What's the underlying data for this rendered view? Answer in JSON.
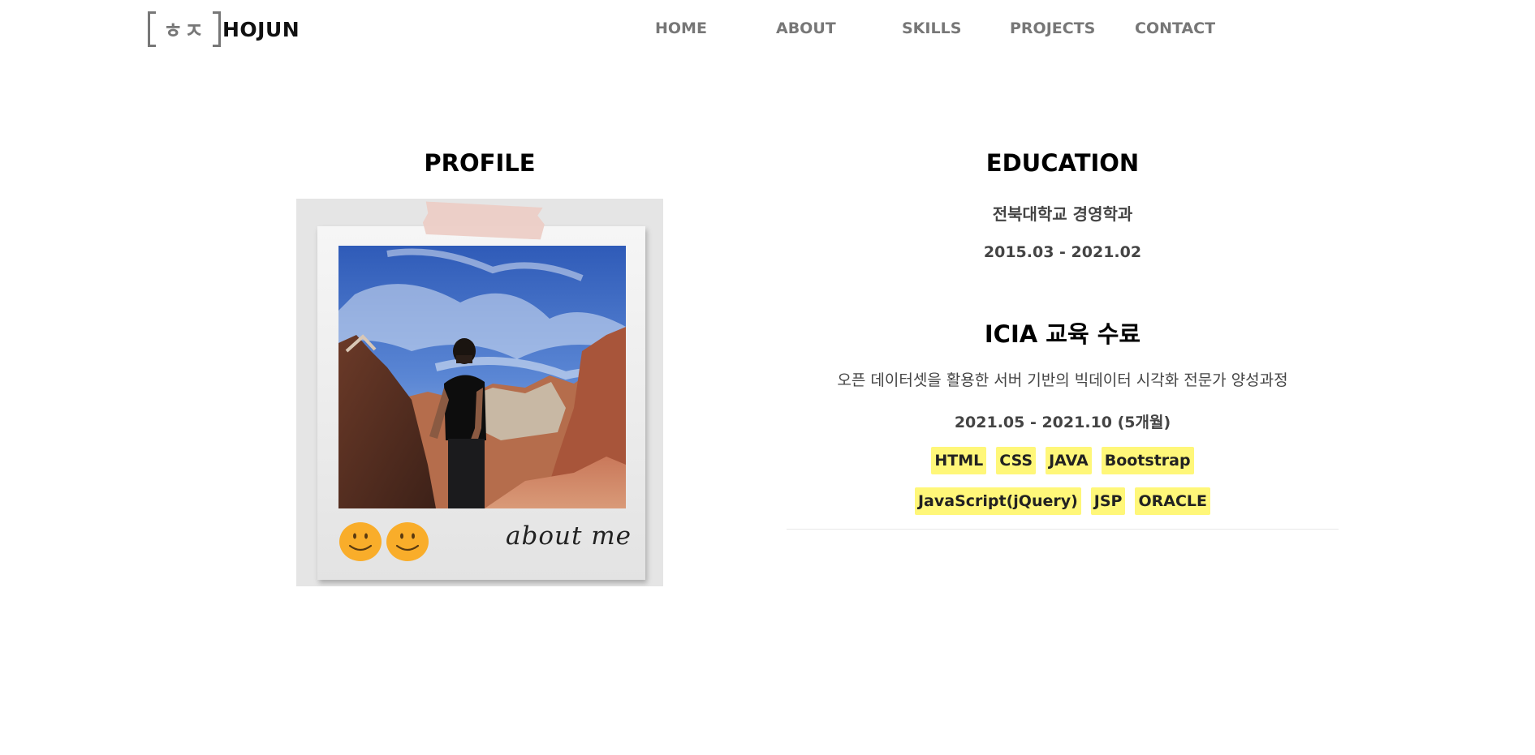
{
  "header": {
    "logo_glyph": "ㅎㅈ",
    "logo_text": "HOJUN",
    "nav": [
      {
        "label": "HOME"
      },
      {
        "label": "ABOUT"
      },
      {
        "label": "SKILLS"
      },
      {
        "label": "PROJECTS"
      },
      {
        "label": "CONTACT"
      }
    ]
  },
  "profile": {
    "title": "PROFILE",
    "caption": "about me",
    "smiley_color": "#f9ad2a"
  },
  "education": {
    "title": "EDUCATION",
    "school": "전북대학교 경영학과",
    "school_period": "2015.03 - 2021.02",
    "icia_title": "ICIA 교육 수료",
    "course": "오픈 데이터셋을 활용한 서버 기반의 빅데이터 시각화 전문가 양성과정",
    "course_period": "2021.05 - 2021.10 (5개월)",
    "tag_color": "#fff779",
    "tags_row1": [
      "HTML",
      "CSS",
      "JAVA",
      "Bootstrap"
    ],
    "tags_row2": [
      "JavaScript(jQuery)",
      "JSP",
      "ORACLE"
    ]
  }
}
